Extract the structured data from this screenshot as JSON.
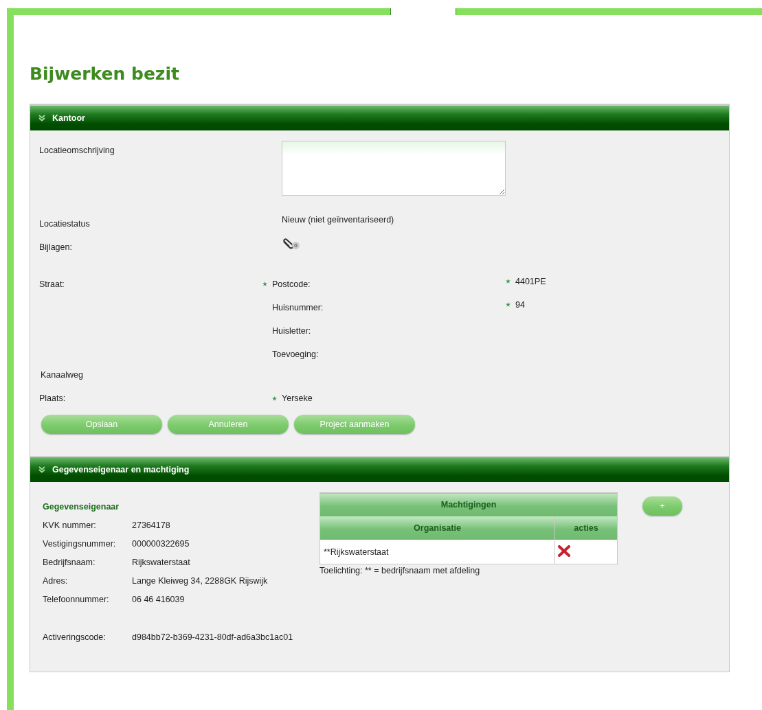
{
  "page_title": "Bijwerken bezit",
  "sections": [
    {
      "title": "Kantoor",
      "expanded": true,
      "kind": "location"
    },
    {
      "title": "Gegevenseigenaar en machtiging",
      "expanded": true,
      "kind": "owner"
    }
  ],
  "location": {
    "description": {
      "label": "Locatieomschrijving"
    },
    "status": {
      "label": "Locatiestatus",
      "value": "Nieuw (niet geïnventariseerd)"
    },
    "attachments": {
      "label": "Bijlagen:",
      "count": "0"
    },
    "street": {
      "label": "Straat:",
      "value": "Kanaalweg"
    },
    "address_fields": [
      {
        "label": "Postcode:",
        "label_required": true,
        "value": "4401PE",
        "value_required": true
      },
      {
        "label": "Huisnummer:",
        "label_required": false,
        "value": "94",
        "value_required": true
      },
      {
        "label": "Huisletter:",
        "label_required": false
      },
      {
        "label": "Toevoeging:",
        "label_required": false
      }
    ],
    "city": {
      "label": "Plaats:",
      "value": "Yerseke",
      "value_required": true
    },
    "buttons": [
      "Opslaan",
      "Annuleren",
      "Project aanmaken"
    ]
  },
  "owner": {
    "heading": "Gegevenseigenaar",
    "details": [
      {
        "label": "KVK nummer:",
        "value": "27364178"
      },
      {
        "label": "Vestigingsnummer:",
        "value": "000000322695"
      },
      {
        "label": "Bedrijfsnaam:",
        "value": "Rijkswaterstaat"
      },
      {
        "label": "Adres:",
        "value": "Lange Kleiweg 34, 2288GK Rijswijk"
      },
      {
        "label": "Telefoonnummer:",
        "value": "06 46 416039"
      }
    ],
    "activation": {
      "label": "Activeringscode:",
      "value": "d984bb72-b369-4231-80df-ad6a3bc1ac01"
    },
    "authorizations": {
      "title": "Machtigingen",
      "columns": [
        "Organisatie",
        "acties"
      ],
      "rows": [
        {
          "organisation": "**Rijkswaterstaat"
        }
      ],
      "note": "Toelichting: ** = bedrijfsnaam met afdeling"
    },
    "add_button": "+"
  }
}
